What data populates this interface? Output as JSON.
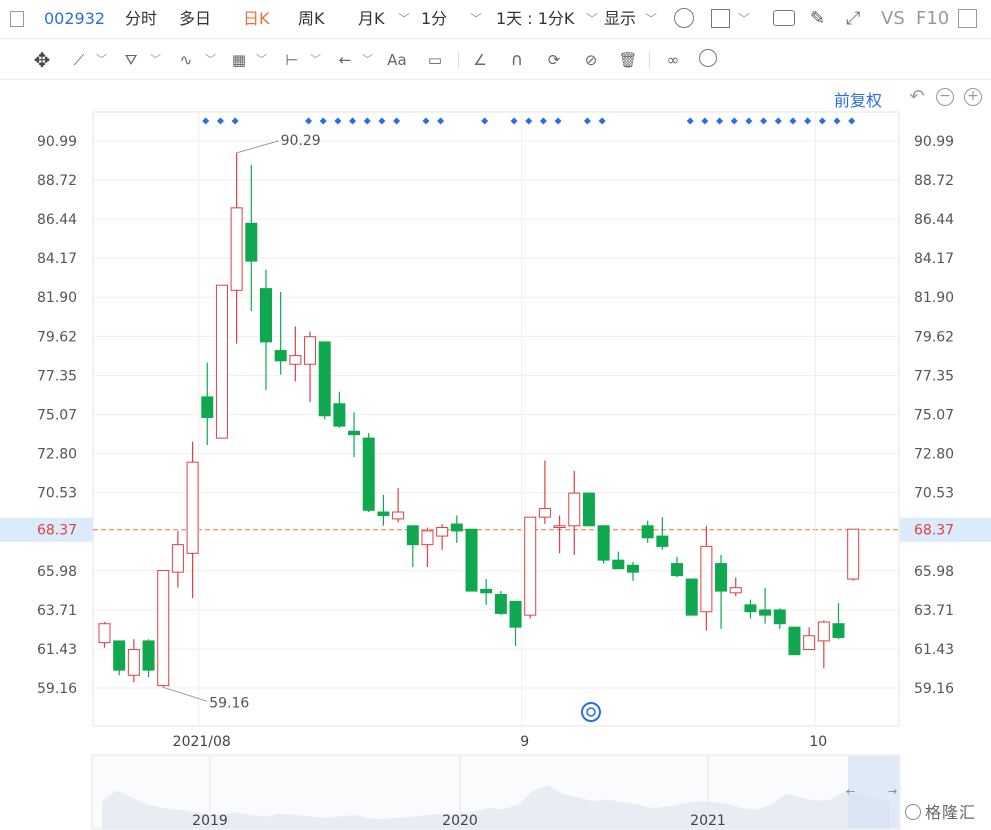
{
  "toolbar": {
    "stock_code": "002932",
    "tabs": [
      "分时",
      "多日",
      "日K",
      "周K",
      "月K",
      "1分"
    ],
    "active_tab": "日K",
    "range_label": "1天 : 1分K",
    "display_label": "显示",
    "vs_label": "VS",
    "f10_label": "F10"
  },
  "chart_controls": {
    "fuquan_label": "前复权"
  },
  "watermark": "格隆汇",
  "colors": {
    "up": "#e04045",
    "down": "#0fa84e",
    "accent": "#2a6ee6",
    "last_price": "#f0703a"
  },
  "chart_data": {
    "type": "candlestick",
    "ylim": [
      57.5,
      92.9
    ],
    "y_ticks": [
      "90.99",
      "88.72",
      "86.44",
      "84.17",
      "81.90",
      "79.62",
      "77.35",
      "75.07",
      "72.80",
      "70.53",
      "68.37",
      "65.98",
      "63.71",
      "61.43",
      "59.16"
    ],
    "x_ticks": [
      {
        "label": "2021/08",
        "index": 7
      },
      {
        "label": "9",
        "index": 29
      },
      {
        "label": "10",
        "index": 49
      }
    ],
    "last_price": "68.37",
    "annotations": {
      "high": "90.29",
      "low": "59.16"
    },
    "candles": [
      {
        "o": 61.8,
        "h": 63.0,
        "l": 61.5,
        "c": 62.9
      },
      {
        "o": 61.9,
        "h": 61.9,
        "l": 59.9,
        "c": 60.2
      },
      {
        "o": 59.9,
        "h": 62.0,
        "l": 59.5,
        "c": 61.4
      },
      {
        "o": 61.9,
        "h": 62.0,
        "l": 59.8,
        "c": 60.2
      },
      {
        "o": 59.3,
        "h": 66.0,
        "l": 59.2,
        "c": 66.0
      },
      {
        "o": 65.9,
        "h": 68.3,
        "l": 65.0,
        "c": 67.5
      },
      {
        "o": 67.0,
        "h": 73.5,
        "l": 64.4,
        "c": 72.3
      },
      {
        "o": 76.1,
        "h": 78.1,
        "l": 73.3,
        "c": 74.9
      },
      {
        "o": 73.7,
        "h": 82.6,
        "l": 73.7,
        "c": 82.6
      },
      {
        "o": 82.3,
        "h": 90.3,
        "l": 79.2,
        "c": 87.1
      },
      {
        "o": 86.2,
        "h": 89.6,
        "l": 81.1,
        "c": 84.0
      },
      {
        "o": 82.4,
        "h": 83.5,
        "l": 76.5,
        "c": 79.3
      },
      {
        "o": 78.8,
        "h": 82.2,
        "l": 77.4,
        "c": 78.2
      },
      {
        "o": 78.0,
        "h": 80.2,
        "l": 77.0,
        "c": 78.5
      },
      {
        "o": 78.0,
        "h": 79.9,
        "l": 75.8,
        "c": 79.6
      },
      {
        "o": 79.3,
        "h": 79.3,
        "l": 74.8,
        "c": 75.0
      },
      {
        "o": 75.7,
        "h": 76.4,
        "l": 74.3,
        "c": 74.4
      },
      {
        "o": 74.1,
        "h": 75.2,
        "l": 72.6,
        "c": 73.9
      },
      {
        "o": 73.7,
        "h": 74.0,
        "l": 69.4,
        "c": 69.5
      },
      {
        "o": 69.4,
        "h": 70.4,
        "l": 68.6,
        "c": 69.2
      },
      {
        "o": 69.0,
        "h": 70.8,
        "l": 68.8,
        "c": 69.4
      },
      {
        "o": 68.6,
        "h": 68.6,
        "l": 66.2,
        "c": 67.5
      },
      {
        "o": 67.5,
        "h": 68.5,
        "l": 66.2,
        "c": 68.3
      },
      {
        "o": 68.0,
        "h": 68.7,
        "l": 67.2,
        "c": 68.5
      },
      {
        "o": 68.7,
        "h": 69.2,
        "l": 67.6,
        "c": 68.3
      },
      {
        "o": 68.4,
        "h": 68.4,
        "l": 64.8,
        "c": 64.8
      },
      {
        "o": 64.9,
        "h": 65.5,
        "l": 64.0,
        "c": 64.7
      },
      {
        "o": 64.6,
        "h": 64.8,
        "l": 63.4,
        "c": 63.5
      },
      {
        "o": 64.2,
        "h": 64.2,
        "l": 61.6,
        "c": 62.7
      },
      {
        "o": 63.4,
        "h": 69.1,
        "l": 63.2,
        "c": 69.1
      },
      {
        "o": 69.1,
        "h": 72.4,
        "l": 68.7,
        "c": 69.6
      },
      {
        "o": 68.5,
        "h": 69.2,
        "l": 67.0,
        "c": 68.6
      },
      {
        "o": 68.6,
        "h": 71.8,
        "l": 66.9,
        "c": 70.5
      },
      {
        "o": 70.5,
        "h": 70.5,
        "l": 68.6,
        "c": 68.6
      },
      {
        "o": 68.6,
        "h": 68.6,
        "l": 66.4,
        "c": 66.6
      },
      {
        "o": 66.6,
        "h": 67.1,
        "l": 66.1,
        "c": 66.1
      },
      {
        "o": 66.3,
        "h": 66.5,
        "l": 65.4,
        "c": 65.9
      },
      {
        "o": 68.6,
        "h": 68.9,
        "l": 67.6,
        "c": 67.9
      },
      {
        "o": 68.0,
        "h": 69.1,
        "l": 67.2,
        "c": 67.4
      },
      {
        "o": 66.4,
        "h": 66.8,
        "l": 65.6,
        "c": 65.7
      },
      {
        "o": 65.5,
        "h": 65.5,
        "l": 63.4,
        "c": 63.4
      },
      {
        "o": 63.6,
        "h": 68.6,
        "l": 62.5,
        "c": 67.4
      },
      {
        "o": 66.4,
        "h": 66.9,
        "l": 62.6,
        "c": 64.8
      },
      {
        "o": 64.7,
        "h": 65.6,
        "l": 64.5,
        "c": 65.0
      },
      {
        "o": 64.0,
        "h": 64.3,
        "l": 63.2,
        "c": 63.6
      },
      {
        "o": 63.7,
        "h": 65.0,
        "l": 62.9,
        "c": 63.4
      },
      {
        "o": 63.7,
        "h": 63.8,
        "l": 62.6,
        "c": 62.9
      },
      {
        "o": 62.7,
        "h": 62.7,
        "l": 61.1,
        "c": 61.1
      },
      {
        "o": 61.4,
        "h": 62.7,
        "l": 61.4,
        "c": 62.2
      },
      {
        "o": 61.9,
        "h": 63.1,
        "l": 60.3,
        "c": 63.0
      },
      {
        "o": 62.9,
        "h": 64.1,
        "l": 62.0,
        "c": 62.1
      },
      {
        "o": 65.5,
        "h": 68.4,
        "l": 65.4,
        "c": 68.4
      }
    ],
    "event_marker_indices": [
      7,
      8,
      9,
      14,
      15,
      16,
      17,
      18,
      19,
      20,
      22,
      23,
      26,
      28,
      29,
      30,
      31,
      33,
      34,
      40,
      41,
      42,
      43,
      44,
      45,
      46,
      47,
      48,
      49,
      50,
      51
    ],
    "navigator": {
      "x_ticks": [
        "2019",
        "2020",
        "2021"
      ]
    }
  }
}
